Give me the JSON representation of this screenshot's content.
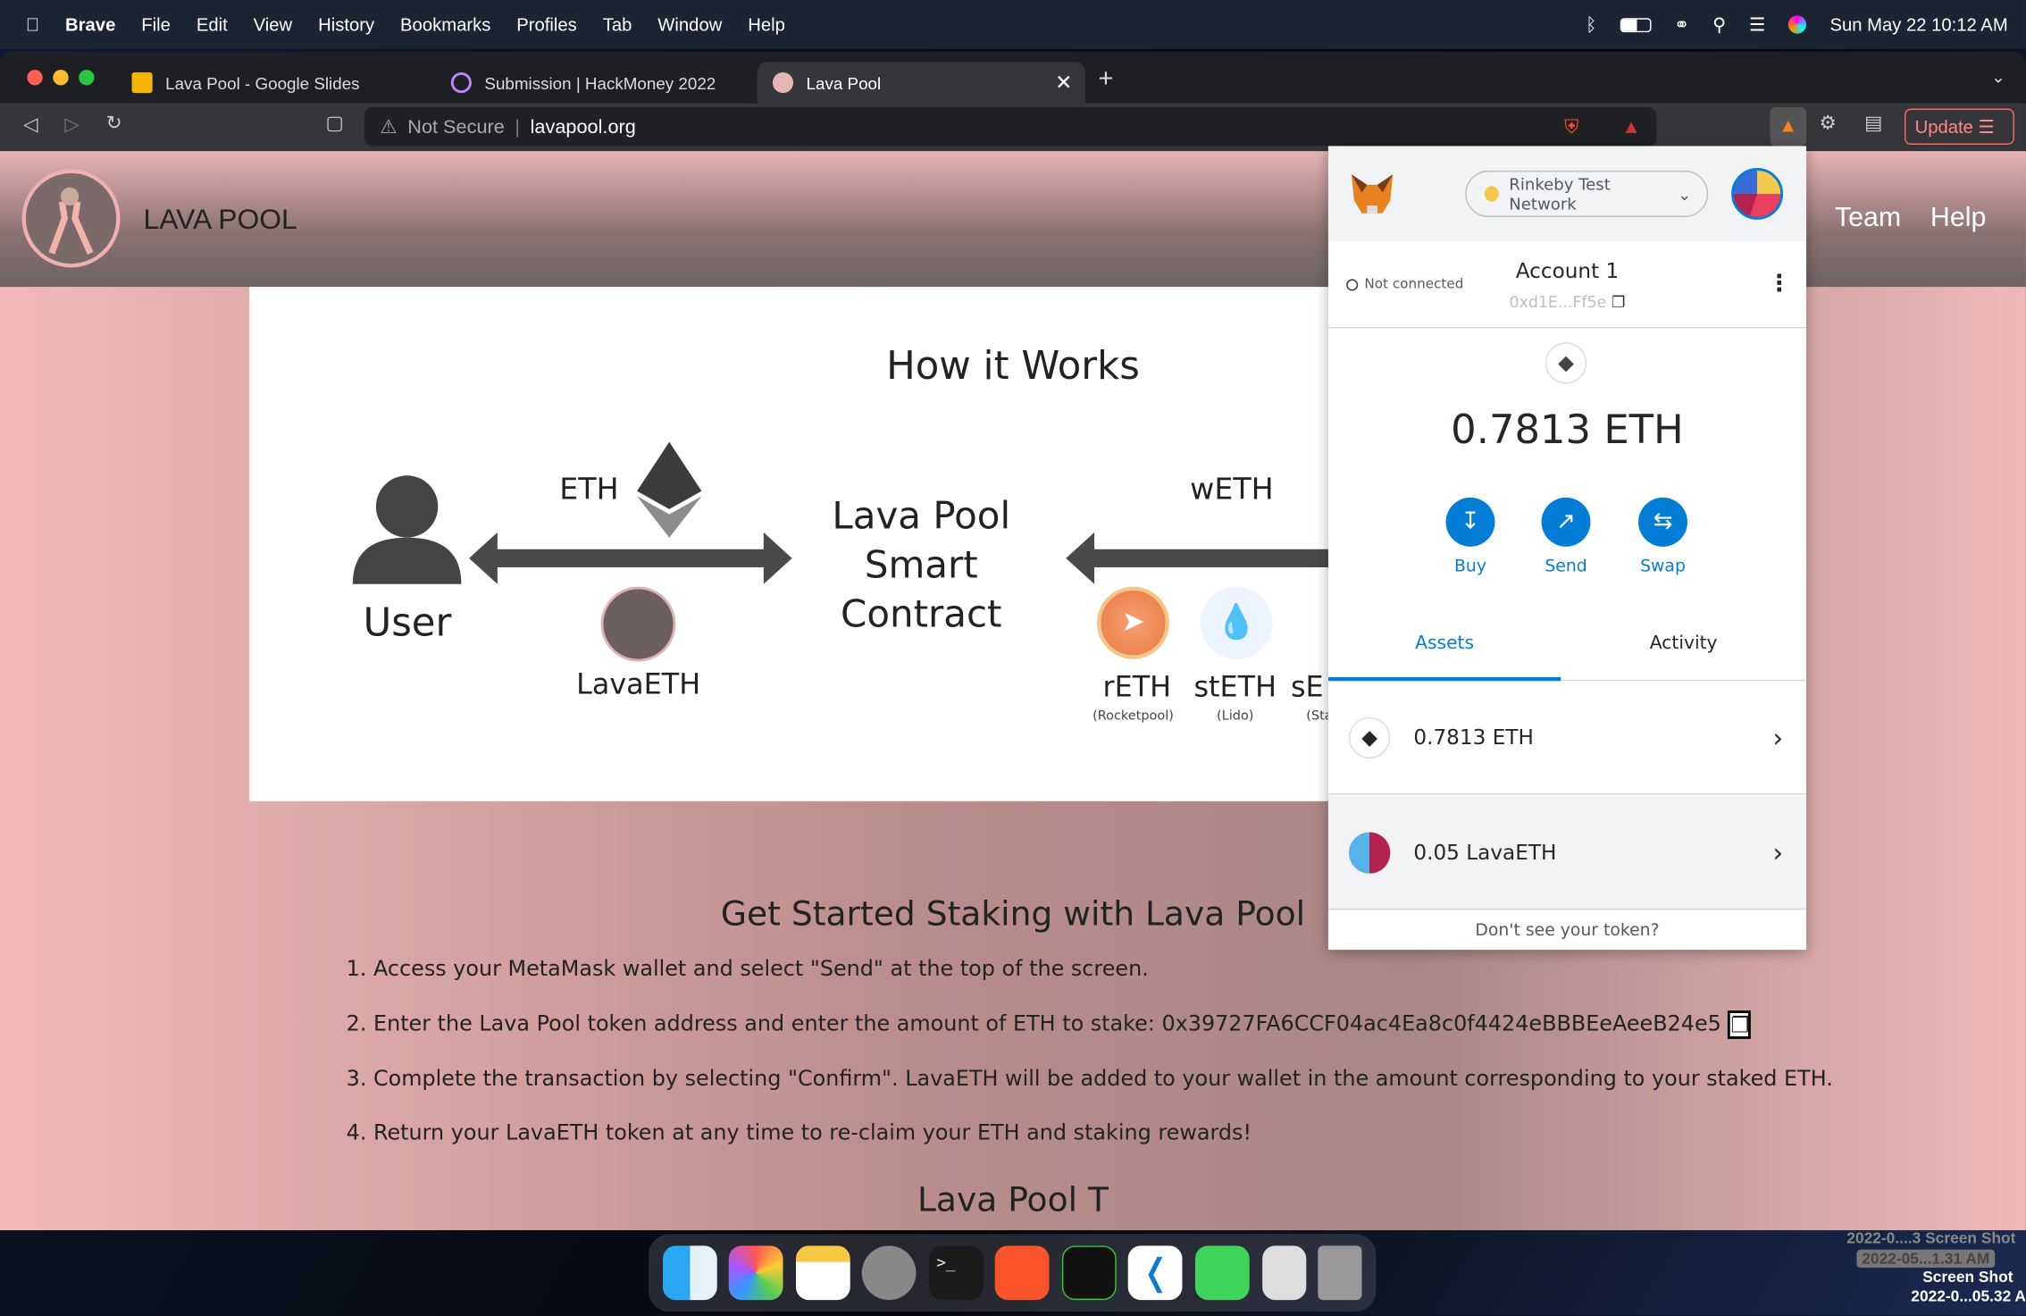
{
  "menubar": {
    "app": "Brave",
    "items": [
      "File",
      "Edit",
      "View",
      "History",
      "Bookmarks",
      "Profiles",
      "Tab",
      "Window",
      "Help"
    ],
    "clock": "Sun May 22  10:12 AM"
  },
  "tabs": [
    {
      "label": "Lava Pool - Google Slides"
    },
    {
      "label": "Submission | HackMoney 2022"
    },
    {
      "label": "Lava Pool",
      "active": true
    }
  ],
  "toolbar": {
    "security": "Not Secure",
    "url": "lavapool.org",
    "update": "Update"
  },
  "site": {
    "name": "LAVA POOL",
    "nav": [
      "Team",
      "Help"
    ]
  },
  "diagram": {
    "title": "How it Works",
    "user": "User",
    "eth": "ETH",
    "lavaeth": "LavaETH",
    "contract": [
      "Lava Pool",
      "Smart",
      "Contract"
    ],
    "weth": "wETH",
    "tokens": [
      {
        "name": "rETH",
        "sub": "(Rocketpool)"
      },
      {
        "name": "stETH",
        "sub": "(Lido)"
      },
      {
        "name": "sE",
        "sub": "(Sta"
      }
    ]
  },
  "getstarted": {
    "title": "Get Started Staking with Lava Pool",
    "steps": [
      "1. Access your MetaMask wallet and select \"Send\" at the top of the screen.",
      "2. Enter the Lava Pool token address and enter the amount of ETH to stake: 0x39727FA6CCF04ac4Ea8c0f4424eBBBEeAeeB24e5",
      "3. Complete the transaction by selecting \"Confirm\". LavaETH will be added to your wallet in the amount corresponding to your staked ETH.",
      "4. Return your LavaETH token at any time to re-claim your ETH and staking rewards!"
    ],
    "next_heading_partial": "Lava Pool T"
  },
  "metamask": {
    "network": "Rinkeby Test Network",
    "status": "Not connected",
    "account": "Account 1",
    "address": "0xd1E...Ff5e",
    "balance": "0.7813 ETH",
    "actions": [
      "Buy",
      "Send",
      "Swap"
    ],
    "tabs": [
      "Assets",
      "Activity"
    ],
    "active_tab": "Assets",
    "assets": [
      {
        "label": "0.7813 ETH"
      },
      {
        "label": "0.05 LavaETH"
      }
    ],
    "footer": "Don't see your token?",
    "accent": "#037dd6"
  },
  "desktop": {
    "files": [
      "2022-0....3 Screen Shot",
      "2022-05...1.31 AM",
      "Screen Shot",
      "2022-0...05.32 A"
    ]
  }
}
